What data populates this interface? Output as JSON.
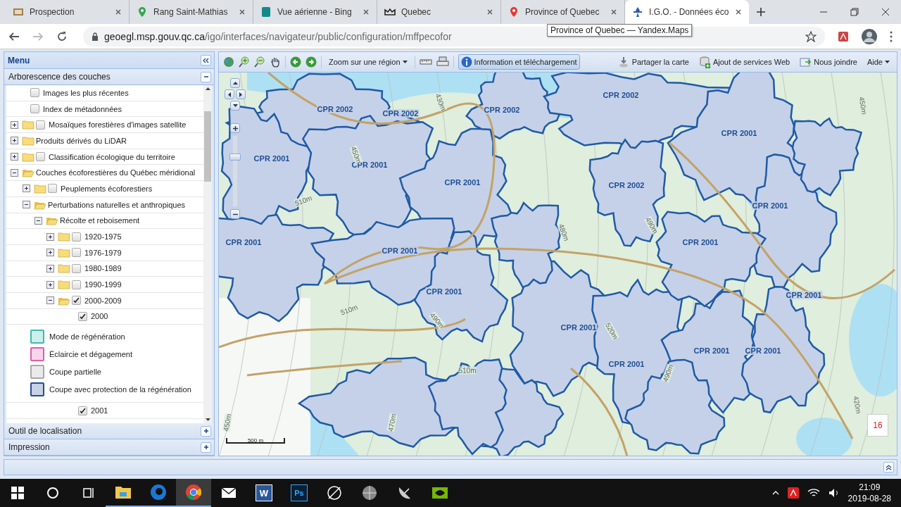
{
  "browser": {
    "tabs": [
      {
        "title": "Prospection",
        "selected": false
      },
      {
        "title": "Rang Saint-Mathias",
        "selected": false
      },
      {
        "title": "Vue aérienne - Bing",
        "selected": false
      },
      {
        "title": "Quebec",
        "selected": false
      },
      {
        "title": "Province of Quebec",
        "selected": false
      },
      {
        "title": "I.G.O. - Données éco",
        "selected": true
      }
    ],
    "url_host": "geoegl.msp.gouv.qc.ca",
    "url_path": "/igo/interfaces/navigateur/public/configuration/mffpecofor",
    "tooltip": "Province of Quebec — Yandex.Maps"
  },
  "panel": {
    "title": "Menu",
    "sections": [
      {
        "title": "Arborescence des couches",
        "expanded": true,
        "items": [
          {
            "label": "Images les plus récentes",
            "kind": "layer",
            "checked": false
          },
          {
            "label": "Index de métadonnées",
            "kind": "layer",
            "checked": false
          },
          {
            "label": "Mosaïques forestières d'images satellite",
            "kind": "folder",
            "expanded": false,
            "checked": false
          },
          {
            "label": "Produits dérivés du LiDAR",
            "kind": "folder",
            "expanded": false
          },
          {
            "label": "Classification écologique du territoire",
            "kind": "folder",
            "expanded": false,
            "checked": false
          },
          {
            "label": "Couches écoforestières du Québec méridional",
            "kind": "folder",
            "expanded": true,
            "children": [
              {
                "label": "Peuplements écoforestiers",
                "kind": "folder",
                "expanded": false,
                "checked": false
              },
              {
                "label": "Perturbations naturelles et anthropiques",
                "kind": "folder",
                "expanded": true,
                "children": [
                  {
                    "label": "Récolte et reboisement",
                    "kind": "folder",
                    "expanded": true,
                    "children": [
                      {
                        "label": "1920-1975",
                        "kind": "folder",
                        "expanded": false,
                        "checked": false
                      },
                      {
                        "label": "1976-1979",
                        "kind": "folder",
                        "expanded": false,
                        "checked": false
                      },
                      {
                        "label": "1980-1989",
                        "kind": "folder",
                        "expanded": false,
                        "checked": false
                      },
                      {
                        "label": "1990-1999",
                        "kind": "folder",
                        "expanded": false,
                        "checked": false
                      },
                      {
                        "label": "2000-2009",
                        "kind": "folder",
                        "expanded": true,
                        "checked": true,
                        "children": [
                          {
                            "label": "2000",
                            "kind": "layer",
                            "checked": true,
                            "legend": [
                              {
                                "label": "Mode de régénération",
                                "color": "#3cbcae"
                              },
                              {
                                "label": "Éclaircie et dégagement",
                                "color": "#e05cb0"
                              },
                              {
                                "label": "Coupe partielle",
                                "color": "#a9a9a9"
                              },
                              {
                                "label": "Coupe avec protection de la régénération",
                                "color": "#1f4f94"
                              }
                            ]
                          },
                          {
                            "label": "2001",
                            "kind": "layer",
                            "checked": true
                          }
                        ]
                      }
                    ]
                  }
                ]
              }
            ]
          }
        ]
      },
      {
        "title": "Outil de localisation",
        "expanded": false
      },
      {
        "title": "Impression",
        "expanded": false
      }
    ]
  },
  "toolbar": {
    "zoom_region": "Zoom sur une région",
    "info_button": {
      "label": "Information et téléchargement",
      "selected": true
    },
    "right": [
      {
        "label": "Partager la carte"
      },
      {
        "label": "Ajout de services Web"
      },
      {
        "label": "Nous joindre"
      }
    ],
    "help": "Aide"
  },
  "map": {
    "zoom_slider": {
      "level": 0.7
    },
    "labels": [
      "CPR 2002",
      "CPR 2002",
      "CPR 2002",
      "CPR 2002",
      "CPR 2001",
      "CPR 2001",
      "CPR 2001",
      "CPR 2002",
      "CPR 2001",
      "CPR 2001",
      "CPR 2001",
      "CPR 2001",
      "CPR 2001",
      "CPR 2001",
      "CPR 2001",
      "CPR 2001",
      "CPR 2001",
      "CPR 2001",
      "CPR 2001"
    ],
    "contour_labels": [
      "450m",
      "480m",
      "490m",
      "510m",
      "490m",
      "510m",
      "520m",
      "490m",
      "470m",
      "450m",
      "420m",
      "430m",
      "450m",
      "510m"
    ],
    "scale": "500 m",
    "badge": "16"
  },
  "taskbar": {
    "word_glyph": "W",
    "photoshop_glyph": "Ps",
    "time": "21:09",
    "date": "2019-08-28"
  }
}
